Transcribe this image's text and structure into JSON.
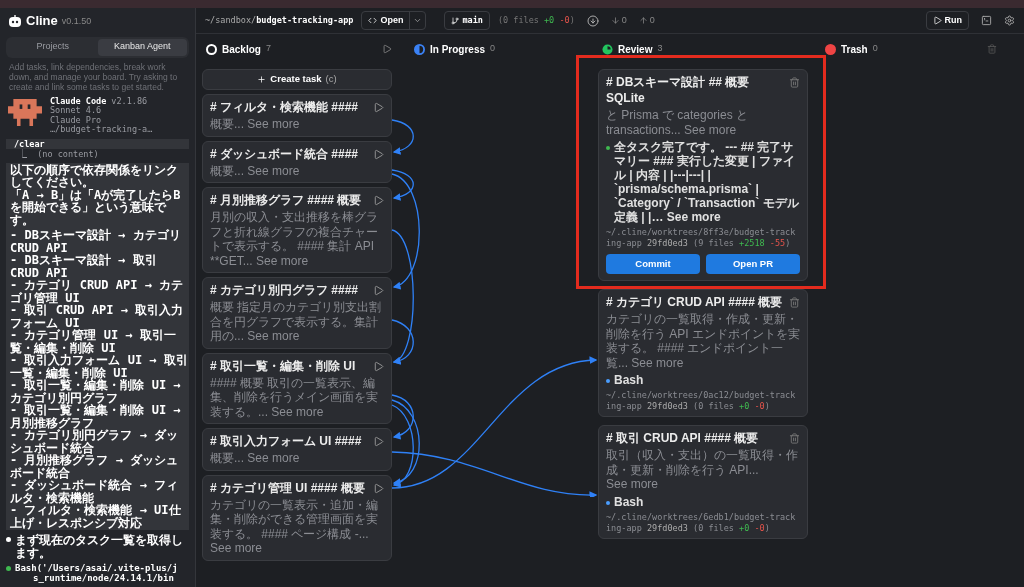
{
  "app": {
    "name": "Cline",
    "version": "v0.1.50"
  },
  "sidebar": {
    "tabs": [
      {
        "label": "Projects",
        "selected": false
      },
      {
        "label": "Kanban Agent",
        "selected": true
      }
    ],
    "hint": "Add tasks, link dependencies, break work down, and manage your board. Try asking to create and link some tasks to get started.",
    "agent": {
      "name": "Claude Code",
      "version": "v2.1.86",
      "lines": [
        "Sonnet 4.6",
        "Claude Pro",
        "…/budget-tracking-a…"
      ]
    },
    "command": {
      "text": "/clear",
      "output": "⎿  (no content)"
    },
    "prompt": {
      "intro": [
        "以下の順序で依存関係をリンクしてください。",
        "「A → B」は「Aが完了したらBを開始できる」という意味です。"
      ],
      "items": [
        "- DBスキーマ設計 → カテゴリ CRUD API",
        "- DBスキーマ設計 → 取引 CRUD API",
        "- カテゴリ CRUD API → カテゴリ管理 UI",
        "- 取引 CRUD API → 取引入力フォーム UI",
        "- カテゴリ管理 UI → 取引一覧・編集・削除 UI",
        "- 取引入力フォーム UI → 取引一覧・編集・削除 UI",
        "- 取引一覧・編集・削除 UI → カテゴリ別円グラフ",
        "- 取引一覧・編集・削除 UI → 月別推移グラフ",
        "- カテゴリ別円グラフ → ダッシュボード統合",
        "- 月別推移グラフ → ダッシュボード統合",
        "- ダッシュボード統合 → フィルタ・検索機能",
        "- フィルタ・検索機能 → UI仕上げ・レスポンシブ対応"
      ]
    },
    "messages": [
      {
        "kind": "text",
        "color": "#ffffff",
        "text": "まず現在のタスク一覧を取得します。"
      },
      {
        "kind": "tool",
        "color": "#3fb950",
        "text": "Bash('/Users/asai/.vite-plus/j",
        "continuation": "s_runtime/node/24.14.1/bin"
      }
    ]
  },
  "toolbar": {
    "path_prefix": "~/sandbox/",
    "path_name": "budget-tracking-app",
    "open_label": "Open",
    "branch": "main",
    "changes": {
      "prefix": "(0 files",
      "added": "+0",
      "removed": "-0",
      "suffix": ")"
    },
    "behind": "0",
    "ahead": "0",
    "run_label": "Run"
  },
  "columns": [
    {
      "kind": "backlog",
      "title": "Backlog",
      "count": "7",
      "create_label": "Create task",
      "create_shortcut": "(c)",
      "cards": [
        {
          "title": "# フィルタ・検索機能 ####",
          "description": "概要...",
          "see_more": "See more"
        },
        {
          "title": "# ダッシュボード統合 ####",
          "description": "概要...",
          "see_more": "See more"
        },
        {
          "title": "# 月別推移グラフ #### 概要",
          "description": "月別の収入・支出推移を棒グラフと折れ線グラフの複合チャートで表示する。 #### 集計 API **GET...",
          "see_more": "See more"
        },
        {
          "title": "# カテゴリ別円グラフ ####",
          "description": "概要 指定月のカテゴリ別支出割合を円グラフで表示する。集計用の...",
          "see_more": "See more"
        },
        {
          "title": "# 取引一覧・編集・削除 UI",
          "description": "#### 概要 取引の一覧表示、編集、削除を行うメイン画面を実装する。...",
          "see_more": "See more"
        },
        {
          "title": "# 取引入力フォーム UI ####",
          "description": "概要...",
          "see_more": "See more"
        },
        {
          "title": "# カテゴリ管理 UI #### 概要",
          "description": "カテゴリの一覧表示・追加・編集・削除ができる管理画面を実装する。 #### ページ構成 -...",
          "see_more": "See more"
        }
      ]
    },
    {
      "kind": "in_progress",
      "title": "In Progress",
      "count": "0"
    },
    {
      "kind": "review",
      "title": "Review",
      "count": "3",
      "cards": [
        {
          "title": "# DBスキーマ設計 ## 概要 SQLite",
          "description": "と Prisma で categories と transactions...",
          "see_more": "See more",
          "highlighted": true,
          "activity": {
            "color": "#3fb950",
            "text": "全タスク完了です。 --- ## 完了サマリー ### 実行した変更 | ファイル | 内容 | |---|---| | `prisma/schema.prisma` | `Category` / `Transaction` モデル定義 | |…",
            "see_more": "See more"
          },
          "worktree": "~/.cline/worktrees/8ff3e/budget-tracking-app",
          "commit": "29fd0ed3",
          "files": "(9 files",
          "added": "+2518",
          "removed": "-55",
          "suffix": ")",
          "buttons": [
            "Commit",
            "Open PR"
          ]
        },
        {
          "title": "# カテゴリ CRUD API #### 概要",
          "description": "カテゴリの一覧取得・作成・更新・削除を行う API エンドポイントを実装する。 #### エンドポイント一覧...",
          "see_more": "See more",
          "highlighted": false,
          "activity": {
            "color": "#4a9eff",
            "text": "Bash"
          },
          "worktree": "~/.cline/worktrees/0ac12/budget-tracking-app",
          "commit": "29fd0ed3",
          "files": "(0 files",
          "added": "+0",
          "removed": "-0",
          "suffix": ")"
        },
        {
          "title": "# 取引 CRUD API #### 概要",
          "description": "取引（収入・支出）の一覧取得・作成・更新・削除を行う API...",
          "see_more": "See more",
          "highlighted": false,
          "activity": {
            "color": "#4a9eff",
            "text": "Bash"
          },
          "worktree": "~/.cline/worktrees/6edb1/budget-tracking-app",
          "commit": "29fd0ed3",
          "files": "(0 files",
          "added": "+0",
          "removed": "-0",
          "suffix": ")"
        }
      ]
    },
    {
      "kind": "trash",
      "title": "Trash",
      "count": "0"
    }
  ]
}
